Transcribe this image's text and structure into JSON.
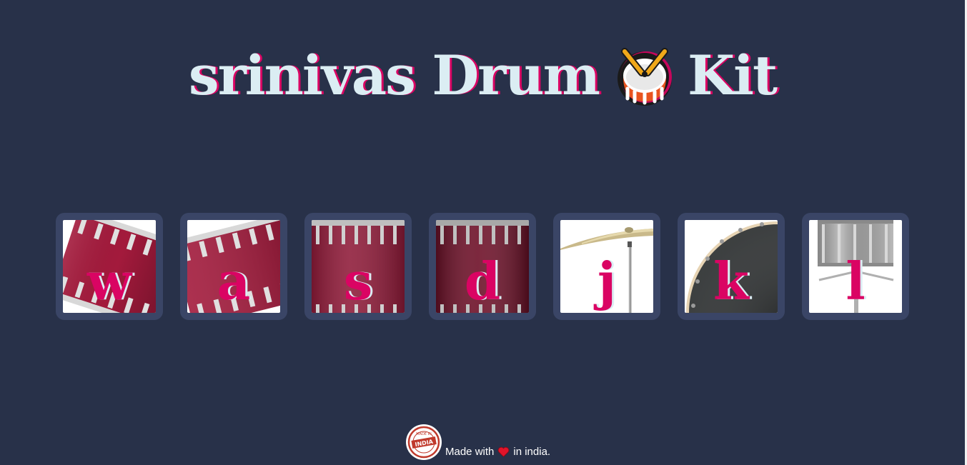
{
  "header": {
    "title_prefix": "srinivas Drum",
    "title_suffix": "Kit",
    "title_emoji": "drum-icon"
  },
  "drums": [
    {
      "key": "w",
      "image": "tom-drum-tilted"
    },
    {
      "key": "a",
      "image": "tom-drum-tilted"
    },
    {
      "key": "s",
      "image": "bass-drum-side"
    },
    {
      "key": "d",
      "image": "bass-drum-side-dark"
    },
    {
      "key": "j",
      "image": "crash-cymbal"
    },
    {
      "key": "k",
      "image": "kick-drum-head"
    },
    {
      "key": "l",
      "image": "snare-drum-stand"
    }
  ],
  "footer": {
    "badge_text": "INDIA",
    "badge_ring_text": "MADE IN",
    "made_with": "Made with",
    "in_text": "in india."
  },
  "colors": {
    "background": "#283149",
    "title": "#dbedf3",
    "accent": "#da0463",
    "tile": "#3a4566"
  }
}
